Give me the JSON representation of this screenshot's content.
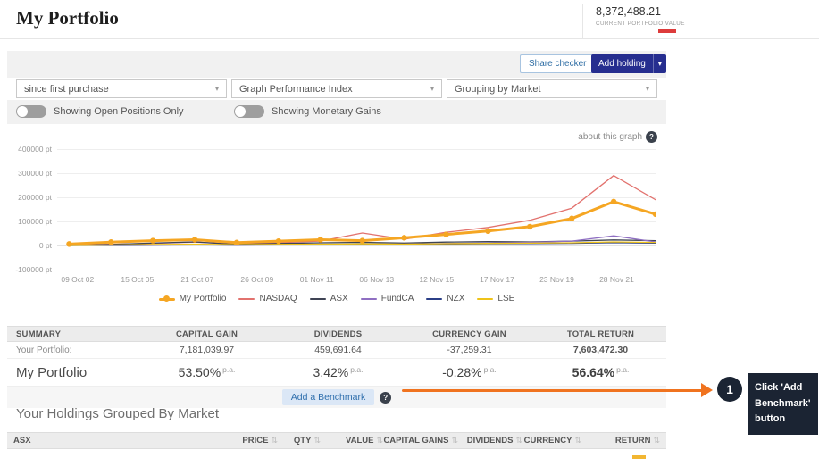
{
  "header": {
    "title": "My Portfolio",
    "portfolio_value": "8,372,488.21",
    "portfolio_value_label": "CURRENT PORTFOLIO VALUE",
    "indicator_color": "#dd3b3b"
  },
  "toolbar": {
    "share_checker": "Share checker",
    "add_holding": "Add holding"
  },
  "filters": {
    "period": "since first purchase",
    "graph_type": "Graph Performance Index",
    "grouping": "Grouping by Market"
  },
  "toggles": [
    {
      "label": "Showing Open Positions Only",
      "on": false
    },
    {
      "label": "Showing Monetary Gains",
      "on": false
    }
  ],
  "chart": {
    "about_link": "about this graph"
  },
  "chart_data": {
    "type": "line",
    "unit": "pt",
    "y_max": 400000,
    "y_min": -100000,
    "y_ticks": [
      400000,
      300000,
      200000,
      100000,
      0,
      -100000
    ],
    "y_tick_labels": [
      "400000 pt",
      "300000 pt",
      "200000 pt",
      "100000 pt",
      "0 pt",
      "-100000 pt"
    ],
    "x_tick_labels": [
      "09 Oct 02",
      "15 Oct 05",
      "21 Oct 07",
      "26 Oct 09",
      "01 Nov 11",
      "06 Nov 13",
      "12 Nov 15",
      "17 Nov 17",
      "23 Nov 19",
      "28 Nov 21"
    ],
    "x_tick_fractions": [
      0.034,
      0.134,
      0.234,
      0.334,
      0.434,
      0.534,
      0.634,
      0.735,
      0.835,
      0.935
    ],
    "sample_fractions": [
      0.02,
      0.09,
      0.16,
      0.23,
      0.3,
      0.37,
      0.44,
      0.51,
      0.58,
      0.65,
      0.72,
      0.79,
      0.86,
      0.93,
      1.0
    ],
    "series": [
      {
        "name": "My Portfolio",
        "color": "#f5a623",
        "width": 3,
        "dots": true,
        "values": [
          6000,
          14000,
          20000,
          24000,
          12000,
          18000,
          24000,
          20000,
          32000,
          46000,
          60000,
          78000,
          112000,
          182000,
          130000
        ]
      },
      {
        "name": "NASDAQ",
        "color": "#e2726e",
        "width": 1.3,
        "values": [
          2000,
          5000,
          9000,
          14000,
          6000,
          12000,
          18000,
          52000,
          26000,
          55000,
          75000,
          105000,
          155000,
          290000,
          190000
        ]
      },
      {
        "name": "ASX",
        "color": "#3f4454",
        "width": 1.3,
        "values": [
          0,
          4000,
          10000,
          15000,
          4000,
          8000,
          11000,
          13000,
          10000,
          14000,
          16000,
          15000,
          18000,
          23000,
          20000
        ]
      },
      {
        "name": "FundCA",
        "color": "#8f6fc2",
        "width": 1.3,
        "values": [
          0,
          1000,
          1500,
          2500,
          1500,
          2500,
          3500,
          4500,
          5500,
          8000,
          10000,
          13000,
          18000,
          40000,
          15000
        ]
      },
      {
        "name": "NZX",
        "color": "#2b3f87",
        "width": 1.3,
        "values": [
          0,
          1000,
          2000,
          3000,
          2000,
          3000,
          4000,
          5000,
          4500,
          6000,
          7000,
          8000,
          9000,
          12000,
          10000
        ]
      },
      {
        "name": "LSE",
        "color": "#efc319",
        "width": 1.3,
        "values": [
          0,
          2000,
          4000,
          5500,
          3000,
          4500,
          5500,
          6500,
          5500,
          7500,
          8500,
          9500,
          11000,
          15000,
          12500
        ]
      }
    ]
  },
  "summary": {
    "headers": [
      "SUMMARY",
      "CAPITAL GAIN",
      "DIVIDENDS",
      "CURRENCY GAIN",
      "TOTAL RETURN"
    ],
    "rows": [
      {
        "label": "Your Portfolio:",
        "values": [
          {
            "text": "7,181,039.97"
          },
          {
            "text": "459,691.64"
          },
          {
            "text": "-37,259.31",
            "negative": true
          },
          {
            "text": "7,603,472.30",
            "bold": true
          }
        ]
      },
      {
        "label": "My Portfolio",
        "values": [
          {
            "text": "53.50%",
            "suffix": "p.a."
          },
          {
            "text": "3.42%",
            "suffix": "p.a."
          },
          {
            "text": "-0.28%",
            "suffix": "p.a.",
            "negative": true
          },
          {
            "text": "56.64%",
            "suffix": "p.a.",
            "bold": true
          }
        ]
      }
    ],
    "add_benchmark": "Add a Benchmark"
  },
  "holdings": {
    "title": "Your Holdings Grouped By Market",
    "group_label": "ASX",
    "columns": [
      "PRICE",
      "QTY",
      "VALUE",
      "CAPITAL GAINS",
      "DIVIDENDS",
      "CURRENCY",
      "RETURN"
    ]
  },
  "annotation": {
    "step": "1",
    "text": "Click 'Add Benchmark' button",
    "arrow_color": "#f0731f"
  }
}
